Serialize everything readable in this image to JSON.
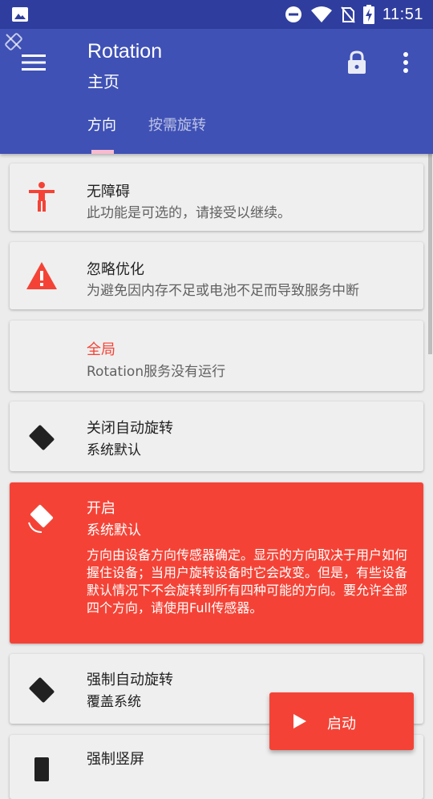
{
  "status_bar": {
    "time": "11:51",
    "icons": [
      "image-notification-icon",
      "do-not-disturb-icon",
      "wifi-icon",
      "no-sim-icon",
      "battery-charging-icon"
    ]
  },
  "app_bar": {
    "title": "Rotation",
    "subtitle": "主页",
    "tabs": [
      {
        "label": "方向",
        "selected": true
      },
      {
        "label": "按需旋转",
        "selected": false
      }
    ],
    "colors": {
      "primary": "#3f51b5",
      "status": "#2f3e9e",
      "indicator": "#f8bbd0"
    }
  },
  "cards": [
    {
      "title": "无障碍",
      "subtitle": "此功能是可选的，请接受以继续。",
      "icon": "accessibility-icon"
    },
    {
      "title": "忽略优化",
      "subtitle": "为避免因内存不足或电池不足而导致服务中断",
      "icon": "warning-icon"
    },
    {
      "title": "全局",
      "subtitle": "Rotation服务没有运行",
      "title_color": "#f44336"
    },
    {
      "title": "关闭自动旋转",
      "subtitle": "系统默认",
      "icon": "rotation-lock-icon"
    },
    {
      "title": "开启",
      "subtitle": "系统默认",
      "icon": "auto-rotate-icon",
      "selected": true,
      "description": "方向由设备方向传感器确定。显示的方向取决于用户如何握住设备；当用户旋转设备时它会改变。但是，有些设备默认情况下不会旋转到所有四种可能的方向。要允许全部四个方向，请使用Full传感器。"
    },
    {
      "title": "强制自动旋转",
      "subtitle": "覆盖系统",
      "icon": "force-rotate-icon"
    },
    {
      "title": "强制竖屏",
      "subtitle": "",
      "icon": "portrait-icon"
    }
  ],
  "fab": {
    "label": "启动",
    "icon": "play-icon",
    "color": "#f44336"
  }
}
